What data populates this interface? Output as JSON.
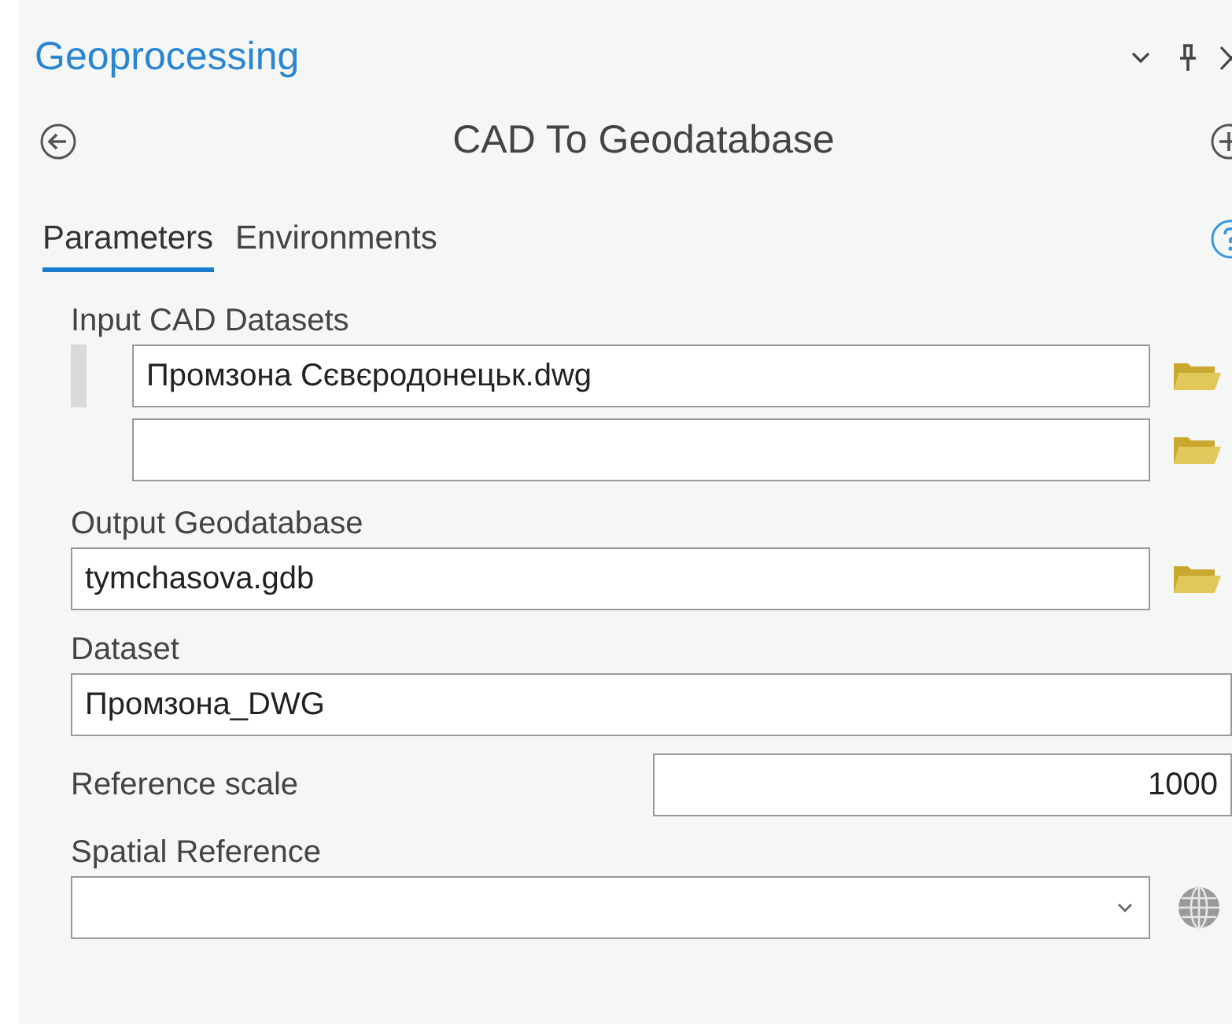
{
  "panel": {
    "title": "Geoprocessing"
  },
  "tool": {
    "title": "CAD To Geodatabase"
  },
  "tabs": [
    {
      "label": "Parameters",
      "selected": true
    },
    {
      "label": "Environments",
      "selected": false
    }
  ],
  "parameters": [
    {
      "kind": "multi",
      "label": "Input CAD Datasets",
      "rows": [
        {
          "kind": "filled",
          "value": "Промзона Сєвєродонецьк.dwg"
        },
        {
          "kind": "empty"
        }
      ]
    },
    {
      "kind": "browse",
      "label": "Output Geodatabase",
      "value": "tymchasova.gdb"
    },
    {
      "kind": "text",
      "label": "Dataset",
      "value": "Промзона_DWG"
    },
    {
      "kind": "inline",
      "label": "Reference scale",
      "value": "1000"
    },
    {
      "kind": "dropdown",
      "label": "Spatial Reference"
    }
  ]
}
